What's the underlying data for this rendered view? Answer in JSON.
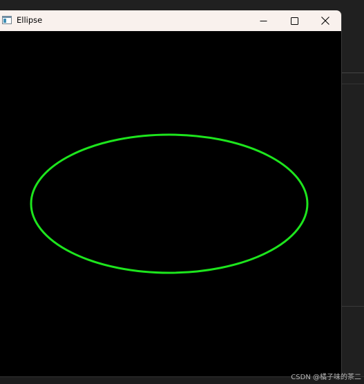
{
  "window": {
    "title": "Ellipse",
    "icon": "app-window-icon",
    "controls": {
      "minimize": "minimize-icon",
      "maximize": "maximize-icon",
      "close": "close-icon"
    }
  },
  "canvas": {
    "background": "#000000",
    "shape": "ellipse",
    "stroke_color": "#1de51d"
  },
  "watermark": {
    "text": "CSDN @橘子味的茶二"
  }
}
